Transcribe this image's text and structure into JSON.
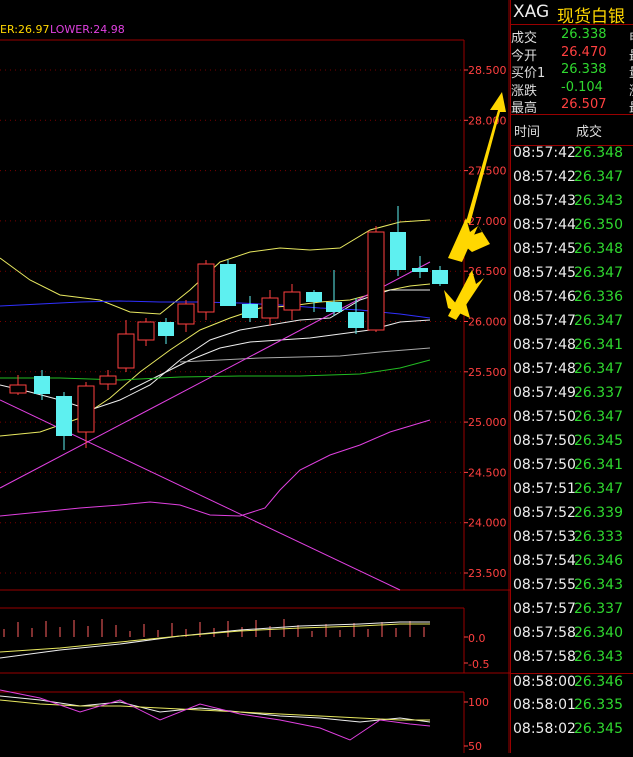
{
  "indicator": {
    "upper": "ER:26.97",
    "lower": "LOWER:24.98"
  },
  "price_axis": [
    "28.500",
    "28.000",
    "27.500",
    "27.000",
    "26.500",
    "26.000",
    "25.500",
    "25.000",
    "24.500",
    "24.000",
    "23.500"
  ],
  "macd_axis": [
    "0.0",
    "-0.5"
  ],
  "kdj_axis": [
    "100",
    "50"
  ],
  "quote": {
    "symbol": "XAG",
    "name": "现货白银",
    "rows": [
      {
        "label": "成交",
        "value": "26.338",
        "color": "green",
        "extra": "申"
      },
      {
        "label": "今开",
        "value": "26.470",
        "color": "red",
        "extra": "最"
      },
      {
        "label": "买价1",
        "value": "26.338",
        "color": "green",
        "extra": "量"
      },
      {
        "label": "涨跌",
        "value": "-0.104",
        "color": "green",
        "extra": "涨"
      },
      {
        "label": "最高",
        "value": "26.507",
        "color": "red",
        "extra": "最"
      }
    ]
  },
  "ticks_header": {
    "time": "时间",
    "price": "成交"
  },
  "ticks": [
    {
      "time": "08:57:42",
      "price": "26.348"
    },
    {
      "time": "08:57:42",
      "price": "26.347"
    },
    {
      "time": "08:57:43",
      "price": "26.343"
    },
    {
      "time": "08:57:44",
      "price": "26.350"
    },
    {
      "time": "08:57:45",
      "price": "26.348"
    },
    {
      "time": "08:57:45",
      "price": "26.347"
    },
    {
      "time": "08:57:46",
      "price": "26.336"
    },
    {
      "time": "08:57:47",
      "price": "26.347"
    },
    {
      "time": "08:57:48",
      "price": "26.341"
    },
    {
      "time": "08:57:48",
      "price": "26.347"
    },
    {
      "time": "08:57:49",
      "price": "26.337"
    },
    {
      "time": "08:57:50",
      "price": "26.347"
    },
    {
      "time": "08:57:50",
      "price": "26.345"
    },
    {
      "time": "08:57:50",
      "price": "26.341"
    },
    {
      "time": "08:57:51",
      "price": "26.347"
    },
    {
      "time": "08:57:52",
      "price": "26.339"
    },
    {
      "time": "08:57:53",
      "price": "26.333"
    },
    {
      "time": "08:57:54",
      "price": "26.346"
    },
    {
      "time": "08:57:55",
      "price": "26.343"
    },
    {
      "time": "08:57:57",
      "price": "26.337"
    },
    {
      "time": "08:57:58",
      "price": "26.340"
    },
    {
      "time": "08:57:58",
      "price": "26.343"
    },
    {
      "time": "08:58:00",
      "price": "26.346"
    },
    {
      "time": "08:58:01",
      "price": "26.335"
    },
    {
      "time": "08:58:02",
      "price": "26.345"
    }
  ],
  "colors": {
    "up": "#ff4040",
    "down": "#5ef0f0",
    "axis": "#990000",
    "yellow": "#ffd700"
  }
}
